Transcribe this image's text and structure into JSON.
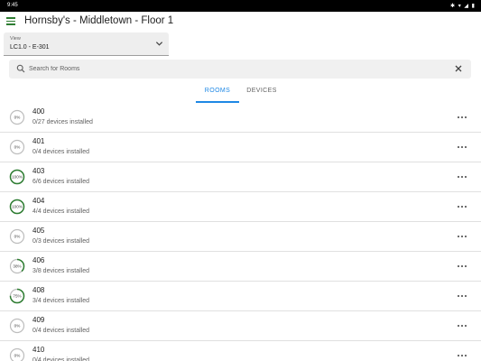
{
  "status_bar": {
    "time": "9:45",
    "icons": "✱ ▾ ◢ ▮"
  },
  "app_bar": {
    "title": "Hornsby's - Middletown - Floor 1",
    "menu_icon": "hamburger-menu-icon"
  },
  "view_select": {
    "label": "View",
    "value": "LC1.0 - E-301"
  },
  "search": {
    "placeholder": "Search for Rooms",
    "value": ""
  },
  "tabs": [
    {
      "label": "ROOMS",
      "active": true
    },
    {
      "label": "DEVICES",
      "active": false
    }
  ],
  "colors": {
    "accent": "#1e88e5",
    "progress": "#2e7d32",
    "track": "#bdbdbd"
  },
  "rooms": [
    {
      "name": "400",
      "devices": "0/27 devices installed",
      "percent_label": "0%",
      "progress": 0
    },
    {
      "name": "401",
      "devices": "0/4 devices installed",
      "percent_label": "0%",
      "progress": 0
    },
    {
      "name": "403",
      "devices": "6/6 devices installed",
      "percent_label": "100%",
      "progress": 1.0
    },
    {
      "name": "404",
      "devices": "4/4 devices installed",
      "percent_label": "100%",
      "progress": 1.0
    },
    {
      "name": "405",
      "devices": "0/3 devices installed",
      "percent_label": "0%",
      "progress": 0
    },
    {
      "name": "406",
      "devices": "3/8 devices installed",
      "percent_label": "38%",
      "progress": 0.38
    },
    {
      "name": "408",
      "devices": "3/4 devices installed",
      "percent_label": "75%",
      "progress": 0.75
    },
    {
      "name": "409",
      "devices": "0/4 devices installed",
      "percent_label": "0%",
      "progress": 0
    },
    {
      "name": "410",
      "devices": "0/4 devices installed",
      "percent_label": "0%",
      "progress": 0
    }
  ]
}
